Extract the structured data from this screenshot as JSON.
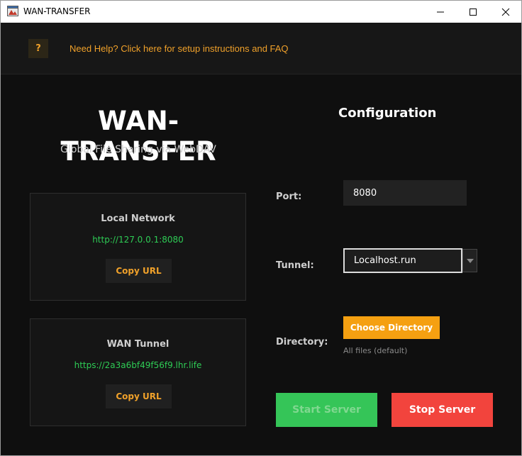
{
  "window": {
    "title": "WAN-TRANSFER"
  },
  "help": {
    "icon_label": "?",
    "link_text": "Need Help? Click here for setup instructions and FAQ"
  },
  "branding": {
    "title": "WAN-TRANSFER",
    "subtitle": "Global File Sharing via WebDAV"
  },
  "local_card": {
    "title": "Local Network",
    "url": "http://127.0.0.1:8080",
    "copy_label": "Copy URL"
  },
  "wan_card": {
    "title": "WAN Tunnel",
    "url": "https://2a3a6bf49f56f9.lhr.life",
    "copy_label": "Copy URL"
  },
  "config": {
    "title": "Configuration",
    "port_label": "Port:",
    "port_value": "8080",
    "tunnel_label": "Tunnel:",
    "tunnel_selected": "Localhost.run",
    "directory_label": "Directory:",
    "choose_label": "Choose Directory",
    "directory_note": "All files (default)"
  },
  "actions": {
    "start_label": "Start Server",
    "stop_label": "Stop Server"
  },
  "colors": {
    "accent": "#f5a011",
    "url_green": "#2ecc55",
    "start_green": "#35c558",
    "stop_red": "#f2443d",
    "background": "#0f0f0f"
  },
  "icons": {
    "app": "app-window-icon",
    "minimize": "minimize-icon",
    "maximize": "maximize-icon",
    "close": "close-icon",
    "dropdown": "chevron-down-icon"
  }
}
